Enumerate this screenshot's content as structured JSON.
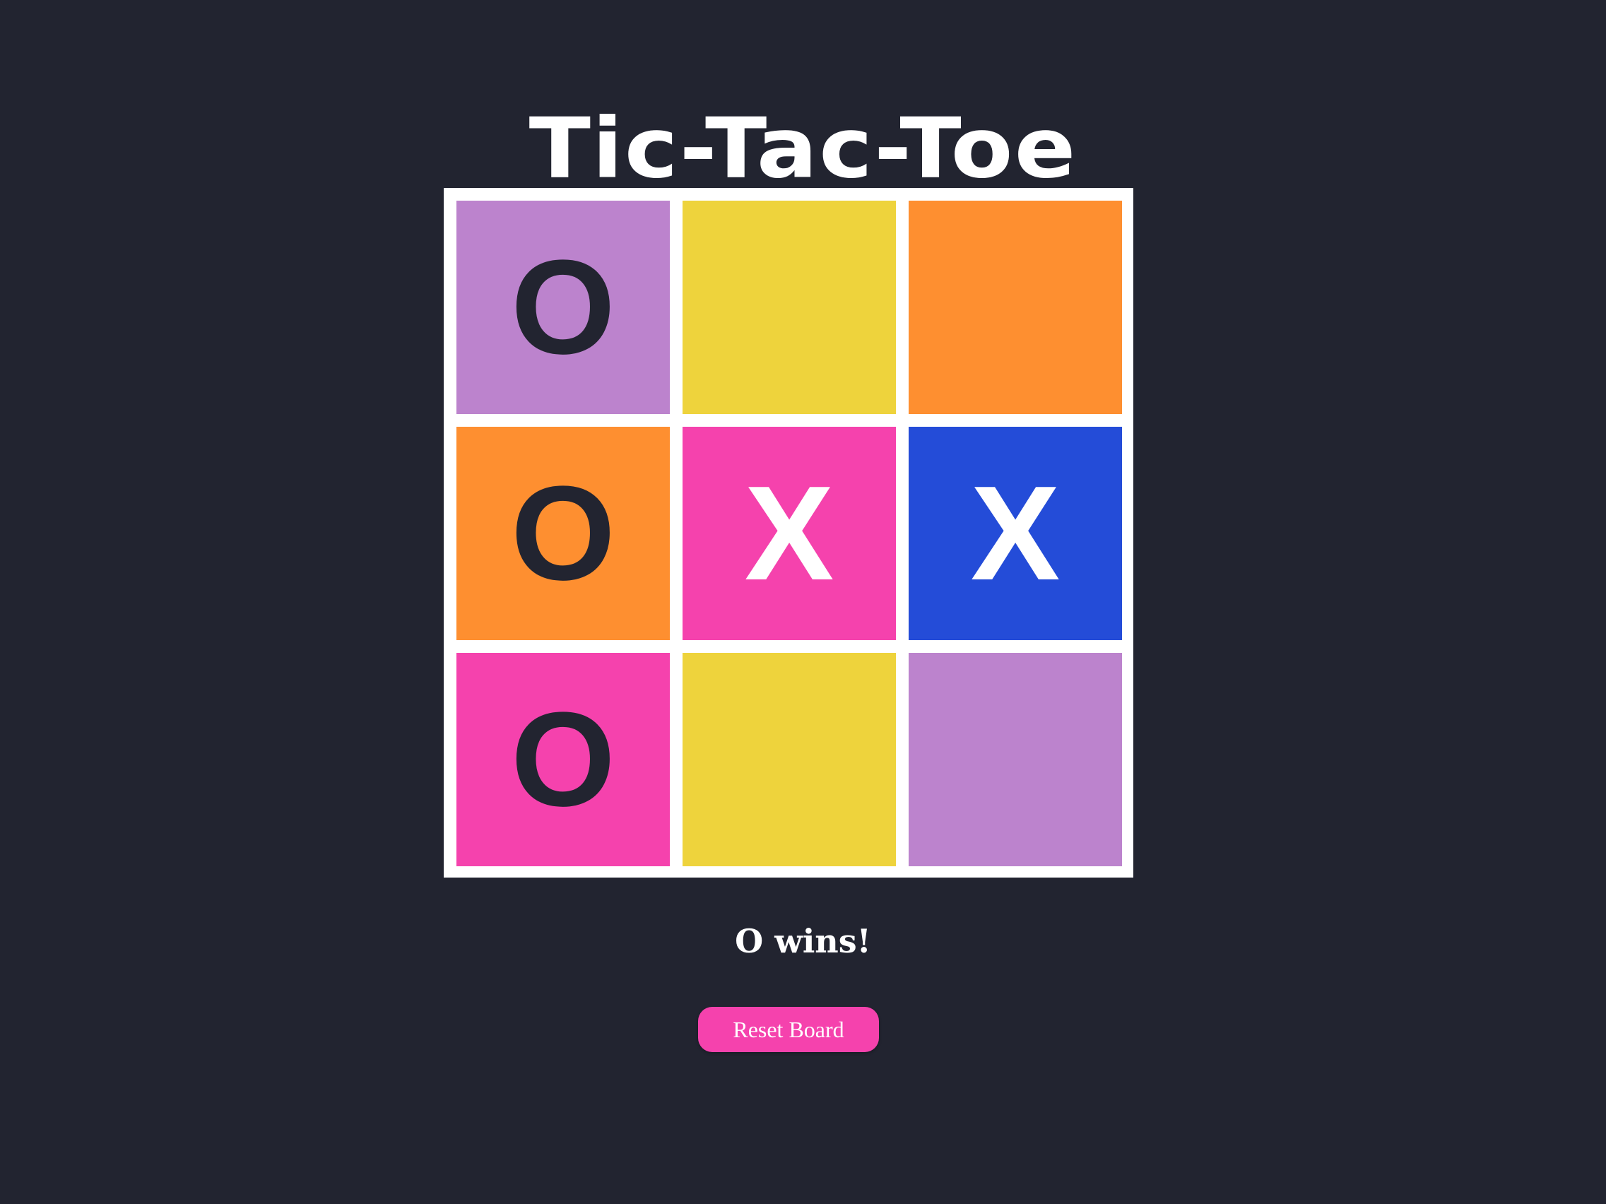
{
  "title": "Tic-Tac-Toe",
  "board": {
    "cells": [
      {
        "mark": "O",
        "color": "#bc83cd"
      },
      {
        "mark": "",
        "color": "#eed33c"
      },
      {
        "mark": "",
        "color": "#fe8f30"
      },
      {
        "mark": "O",
        "color": "#fe8f30"
      },
      {
        "mark": "X",
        "color": "#f542ad"
      },
      {
        "mark": "X",
        "color": "#244cd8"
      },
      {
        "mark": "O",
        "color": "#f542ad"
      },
      {
        "mark": "",
        "color": "#eed33c"
      },
      {
        "mark": "",
        "color": "#bc83cd"
      }
    ]
  },
  "status": "O wins!",
  "reset_label": "Reset Board",
  "colors": {
    "background": "#222430",
    "board_lines": "#ffffff",
    "mark_o": "#222430",
    "mark_x": "#ffffff",
    "button": "#f542ad"
  }
}
